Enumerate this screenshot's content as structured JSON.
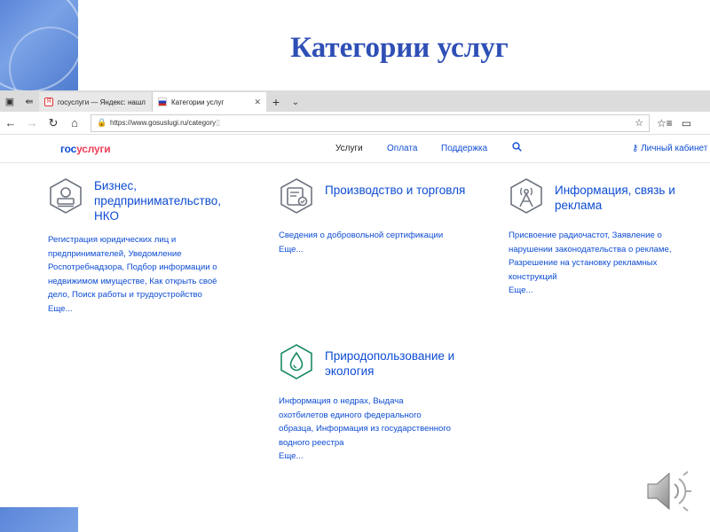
{
  "slide": {
    "title": "Категории услуг"
  },
  "browser": {
    "tabs": [
      {
        "label": "госуслуги — Яндекс: нашл",
        "active": false
      },
      {
        "label": "Категории услуг",
        "active": true
      }
    ],
    "url": "https://www.gosuslugi.ru/category"
  },
  "site": {
    "logo_part1": "гос",
    "logo_part2": "услуги",
    "menu": {
      "services": "Услуги",
      "payment": "Оплата",
      "support": "Поддержка"
    },
    "cabinet": "Личный кабинет"
  },
  "categories": [
    {
      "title": "Бизнес, предпринимательство, НКО",
      "icon": "business-stamp-icon",
      "links": [
        "Регистрация юридических лиц и",
        "предпринимателей, Уведомление",
        "Роспотребнадзора, Подбор информации о",
        "недвижимом имуществе, Как открыть своё",
        "дело, Поиск работы и трудоустройство",
        "Еще..."
      ]
    },
    {
      "title": "Производство и торговля",
      "icon": "certificate-icon",
      "links": [
        "Сведения о добровольной сертификации",
        "Еще..."
      ]
    },
    {
      "title": "Информация, связь и реклама",
      "icon": "antenna-icon",
      "links": [
        "Присвоение радиочастот, Заявление о",
        "нарушении законодательства о рекламе,",
        "Разрешение на установку рекламных",
        "конструкций",
        "Еще..."
      ]
    },
    {
      "title": "Природопользование и экология",
      "icon": "water-drop-icon",
      "links": [
        "Информация о недрах, Выдача",
        "охотбилетов единого федерального",
        "образца, Информация из государственного",
        "водного реестра",
        "Еще..."
      ]
    }
  ],
  "colors": {
    "accent": "#0d4cd3",
    "title": "#2e4fb5",
    "logo_red": "#ee3f58",
    "icon_gray": "#6f7580",
    "icon_green": "#1a8a66"
  }
}
